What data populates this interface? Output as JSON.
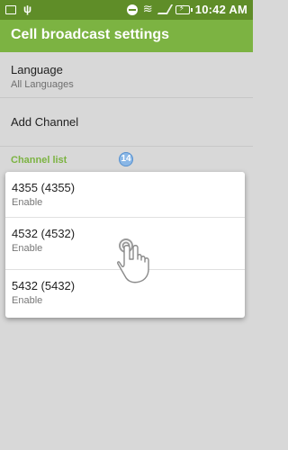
{
  "status_bar": {
    "icons_left": [
      "image-icon",
      "usb-icon"
    ],
    "icons_right": [
      "dnd-icon",
      "wifi-icon",
      "signal-off-icon",
      "battery-charging-icon"
    ],
    "time": "10:42 AM",
    "colors": {
      "bg": "#5f8d28",
      "fg": "#ffffff"
    }
  },
  "app_bar": {
    "title": "Cell broadcast settings",
    "color": "#7cb342"
  },
  "settings": {
    "language": {
      "title": "Language",
      "summary": "All Languages"
    },
    "add_channel": {
      "title": "Add Channel"
    },
    "channel_list_header": "Channel list",
    "badge": "14"
  },
  "channels": [
    {
      "title": "4355 (4355)",
      "status": "Enable"
    },
    {
      "title": "4532 (4532)",
      "status": "Enable"
    },
    {
      "title": "5432 (5432)",
      "status": "Enable"
    }
  ],
  "accent": "#7cb342"
}
